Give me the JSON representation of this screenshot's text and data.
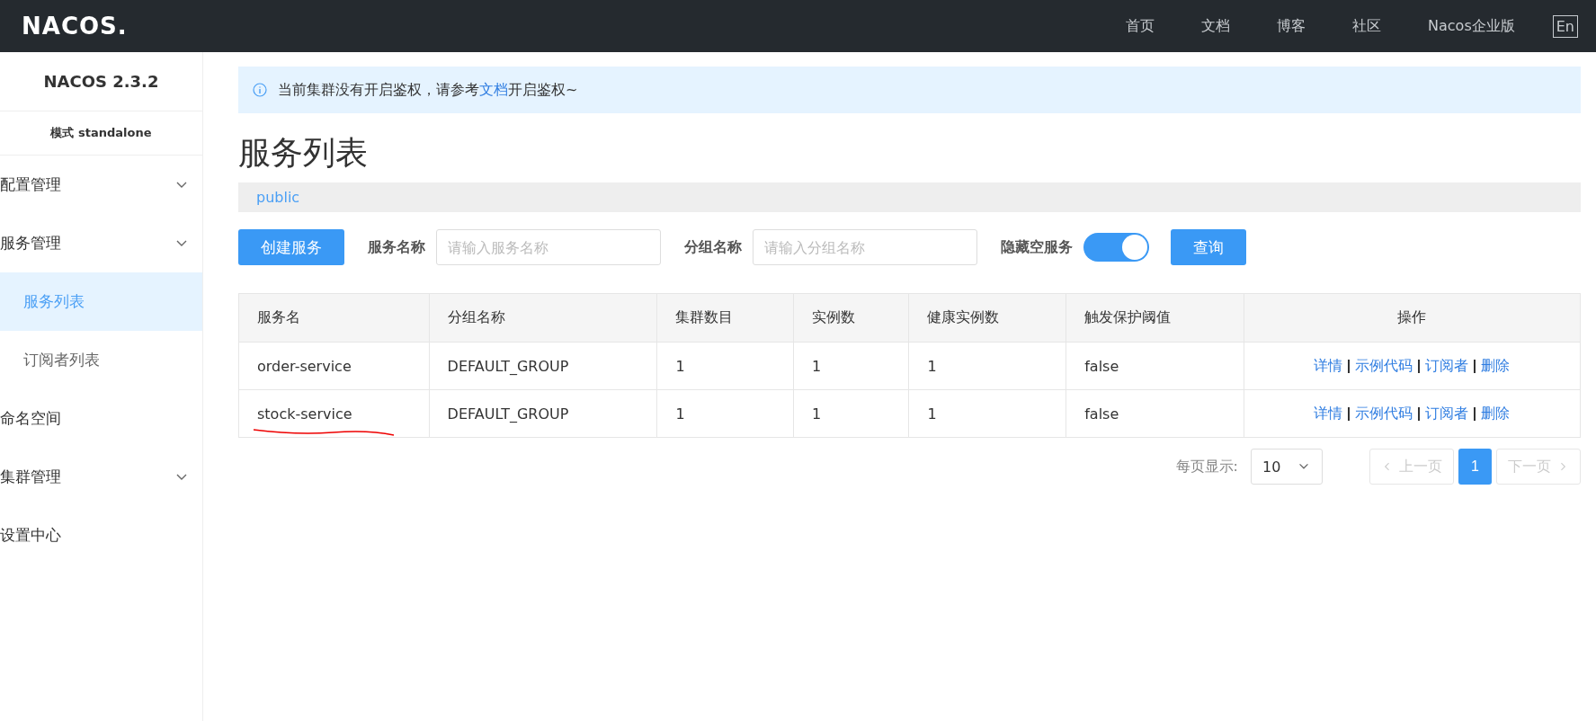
{
  "topbar": {
    "logo": "NACOS.",
    "nav": [
      {
        "label": "首页"
      },
      {
        "label": "文档"
      },
      {
        "label": "博客"
      },
      {
        "label": "社区"
      },
      {
        "label": "Nacos企业版"
      }
    ],
    "lang": "En"
  },
  "sidebar": {
    "title": "NACOS 2.3.2",
    "mode": "模式 standalone",
    "items": [
      {
        "label": "配置管理",
        "expandable": true
      },
      {
        "label": "服务管理",
        "expandable": true,
        "children": [
          {
            "label": "服务列表",
            "selected": true
          },
          {
            "label": "订阅者列表",
            "selected": false
          }
        ]
      },
      {
        "label": "命名空间",
        "expandable": false
      },
      {
        "label": "集群管理",
        "expandable": true
      },
      {
        "label": "设置中心",
        "expandable": false
      }
    ]
  },
  "notice": {
    "before": "当前集群没有开启鉴权，请参考",
    "link": "文档",
    "after": "开启鉴权~"
  },
  "page_title": "服务列表",
  "namespace": "public",
  "toolbar": {
    "create_button": "创建服务",
    "service_label": "服务名称",
    "service_placeholder": "请输入服务名称",
    "group_label": "分组名称",
    "group_placeholder": "请输入分组名称",
    "hide_empty_label": "隐藏空服务",
    "hide_empty_on": true,
    "query_button": "查询"
  },
  "table": {
    "columns": [
      "服务名",
      "分组名称",
      "集群数目",
      "实例数",
      "健康实例数",
      "触发保护阈值",
      "操作"
    ],
    "rows": [
      {
        "cells": [
          "order-service",
          "DEFAULT_GROUP",
          "1",
          "1",
          "1",
          "false"
        ],
        "actions": [
          "详情",
          "示例代码",
          "订阅者",
          "删除"
        ],
        "underlined": false
      },
      {
        "cells": [
          "stock-service",
          "DEFAULT_GROUP",
          "1",
          "1",
          "1",
          "false"
        ],
        "actions": [
          "详情",
          "示例代码",
          "订阅者",
          "删除"
        ],
        "underlined": true
      }
    ]
  },
  "pagination": {
    "page_size_label": "每页显示:",
    "page_size": "10",
    "prev": "上一页",
    "prev_disabled": true,
    "pages": [
      {
        "label": "1",
        "selected": true
      }
    ],
    "next": "下一页",
    "next_disabled": true
  }
}
